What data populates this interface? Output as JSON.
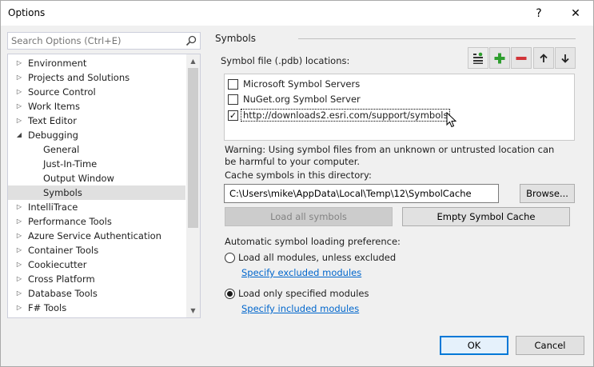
{
  "window": {
    "title": "Options",
    "help_glyph": "?",
    "close_glyph": "✕"
  },
  "search": {
    "placeholder": "Search Options (Ctrl+E)"
  },
  "tree": {
    "items": [
      {
        "label": "Environment",
        "arrow": "▷"
      },
      {
        "label": "Projects and Solutions",
        "arrow": "▷"
      },
      {
        "label": "Source Control",
        "arrow": "▷"
      },
      {
        "label": "Work Items",
        "arrow": "▷"
      },
      {
        "label": "Text Editor",
        "arrow": "▷"
      },
      {
        "label": "Debugging",
        "arrow": "◢"
      },
      {
        "label": "General",
        "arrow": ""
      },
      {
        "label": "Just-In-Time",
        "arrow": ""
      },
      {
        "label": "Output Window",
        "arrow": ""
      },
      {
        "label": "Symbols",
        "arrow": ""
      },
      {
        "label": "IntelliTrace",
        "arrow": "▷"
      },
      {
        "label": "Performance Tools",
        "arrow": "▷"
      },
      {
        "label": "Azure Service Authentication",
        "arrow": "▷"
      },
      {
        "label": "Container Tools",
        "arrow": "▷"
      },
      {
        "label": "Cookiecutter",
        "arrow": "▷"
      },
      {
        "label": "Cross Platform",
        "arrow": "▷"
      },
      {
        "label": "Database Tools",
        "arrow": "▷"
      },
      {
        "label": "F# Tools",
        "arrow": "▷"
      }
    ],
    "scroll_up": "▲",
    "scroll_down": "▼"
  },
  "symbols": {
    "section_title": "Symbols",
    "locations_label": "Symbol file (.pdb) locations:",
    "locations": [
      {
        "label": "Microsoft Symbol Servers",
        "checked": false
      },
      {
        "label": "NuGet.org Symbol Server",
        "checked": false
      },
      {
        "label": "http://downloads2.esri.com/support/symbols",
        "checked": true
      }
    ],
    "check_glyph": "✓",
    "toolbar_icons": [
      "filter-list-icon",
      "add-icon",
      "remove-icon",
      "move-up-icon",
      "move-down-icon"
    ],
    "warning": "Warning: Using symbol files from an unknown or untrusted location can be harmful to your computer.",
    "cache_label": "Cache symbols in this directory:",
    "cache_path": "C:\\Users\\mike\\AppData\\Local\\Temp\\12\\SymbolCache",
    "browse_label": "Browse...",
    "load_all_label": "Load all symbols",
    "empty_cache_label": "Empty Symbol Cache",
    "loading_pref_label": "Automatic symbol loading preference:",
    "radio_all_label": "Load all modules, unless excluded",
    "radio_all_selected": false,
    "link_excluded": "Specify excluded modules",
    "radio_specified_label": "Load only specified modules",
    "radio_specified_selected": true,
    "link_included": "Specify included modules"
  },
  "footer": {
    "ok_label": "OK",
    "cancel_label": "Cancel"
  },
  "colors": {
    "accent": "#0078d7",
    "link": "#0066cc",
    "selection": "#cce8ff",
    "add_green": "#2e9e2e",
    "remove_red": "#d13438"
  }
}
